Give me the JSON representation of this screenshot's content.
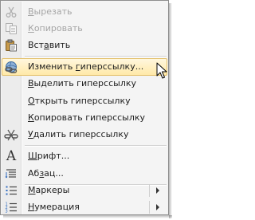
{
  "menu": {
    "items": [
      {
        "key": "cut",
        "label": "Вырезать",
        "ul": "В",
        "rest": "ырезать",
        "disabled": true,
        "icon": "scissors-icon"
      },
      {
        "key": "copy",
        "label": "Копировать",
        "ul": "К",
        "rest": "опировать",
        "disabled": true,
        "icon": "copy-icon"
      },
      {
        "key": "paste",
        "label": "Вставить",
        "pre": "Вст",
        "ul": "а",
        "rest": "вить",
        "disabled": false,
        "icon": "paste-icon"
      },
      {
        "key": "edit-link",
        "label": "Изменить гиперссылку...",
        "pre": "Изменить ",
        "ul": "г",
        "rest": "иперссылку...",
        "disabled": false,
        "highlighted": true,
        "icon": "hyperlink-icon"
      },
      {
        "key": "select-link",
        "label": "Выделить гиперссылку",
        "ul": "В",
        "rest": "ыделить гиперссылку",
        "disabled": false
      },
      {
        "key": "open-link",
        "label": "Открыть гиперссылку",
        "ul": "О",
        "rest": "ткрыть гиперссылку",
        "disabled": false
      },
      {
        "key": "copy-link",
        "label": "Копировать гиперссылку",
        "ul": "К",
        "rest": "опировать гиперссылку",
        "disabled": false
      },
      {
        "key": "remove-link",
        "label": "Удалить гиперссылку",
        "ul": "У",
        "rest": "далить гиперссылку",
        "disabled": false,
        "icon": "unlink-icon"
      },
      {
        "key": "font",
        "label": "Шрифт...",
        "ul": "Ш",
        "rest": "рифт...",
        "disabled": false,
        "icon": "font-icon"
      },
      {
        "key": "paragraph",
        "label": "Абзац...",
        "pre": "Аб",
        "ul": "з",
        "rest": "ац...",
        "disabled": false,
        "icon": "paragraph-icon"
      },
      {
        "key": "bullets",
        "label": "Маркеры",
        "ul": "М",
        "rest": "аркеры",
        "disabled": false,
        "submenu": true,
        "icon": "bullets-icon"
      },
      {
        "key": "numbering",
        "label": "Нумерация",
        "ul": "Н",
        "rest": "умерация",
        "disabled": false,
        "submenu": true,
        "icon": "numbering-icon"
      }
    ]
  },
  "colors": {
    "highlight_border": "#e3c06a",
    "highlight_fill": "#ffe9a8",
    "disabled_text": "#a6a6a6",
    "menu_bg": "#f4f4f4"
  }
}
